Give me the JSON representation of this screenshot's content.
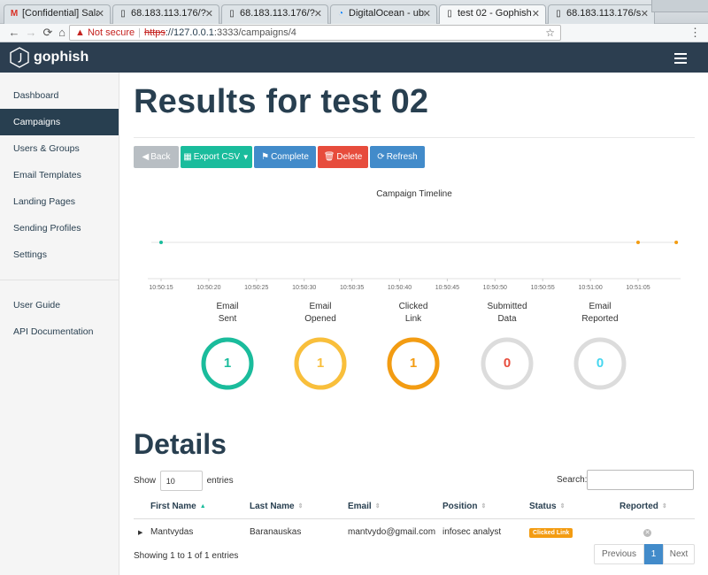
{
  "browser": {
    "tabs": [
      {
        "title": "[Confidential] Salar",
        "icon": "gmail-icon"
      },
      {
        "title": "68.183.113.176/?",
        "icon": "page-icon"
      },
      {
        "title": "68.183.113.176/?",
        "icon": "page-icon"
      },
      {
        "title": "DigitalOcean - ubun",
        "icon": "digitalocean-icon"
      },
      {
        "title": "test 02 - Gophish",
        "icon": "page-icon"
      },
      {
        "title": "68.183.113.176/s",
        "icon": "page-icon"
      }
    ],
    "active_tab": 4,
    "security": "Not secure",
    "url_scheme": "https",
    "url_host": "://127.0.0.1",
    "url_rest": ":3333/campaigns/4"
  },
  "app": {
    "brand": "gophish"
  },
  "sidebar": {
    "items": [
      {
        "label": "Dashboard"
      },
      {
        "label": "Campaigns"
      },
      {
        "label": "Users & Groups"
      },
      {
        "label": "Email Templates"
      },
      {
        "label": "Landing Pages"
      },
      {
        "label": "Sending Profiles"
      },
      {
        "label": "Settings"
      }
    ],
    "active_index": 1,
    "secondary": [
      {
        "label": "User Guide"
      },
      {
        "label": "API Documentation"
      }
    ]
  },
  "page": {
    "title": "Results for test 02"
  },
  "actions": {
    "back": "Back",
    "export": "Export CSV",
    "complete": "Complete",
    "delete": "Delete",
    "refresh": "Refresh"
  },
  "timeline": {
    "title": "Campaign Timeline",
    "ticks": [
      "10:50:15",
      "10:50:20",
      "10:50:25",
      "10:50:30",
      "10:50:35",
      "10:50:40",
      "10:50:45",
      "10:50:50",
      "10:50:55",
      "10:51:00",
      "10:51:05"
    ]
  },
  "chart_data": {
    "type": "scatter",
    "title": "Campaign Timeline",
    "x_ticks": [
      "10:50:15",
      "10:50:20",
      "10:50:25",
      "10:50:30",
      "10:50:35",
      "10:50:40",
      "10:50:45",
      "10:50:50",
      "10:50:55",
      "10:51:00",
      "10:51:05"
    ],
    "events": [
      {
        "time": "10:50:15",
        "color": "#1abc9c"
      },
      {
        "time": "10:51:05",
        "color": "#f39c12"
      },
      {
        "time": "10:51:09",
        "color": "#f39c12"
      }
    ]
  },
  "stats": [
    {
      "label1": "Email",
      "label2": "Sent",
      "value": "1",
      "color": "#1abc9c",
      "fraction": 1
    },
    {
      "label1": "Email",
      "label2": "Opened",
      "value": "1",
      "color": "#f9bf3b",
      "fraction": 1
    },
    {
      "label1": "Clicked",
      "label2": "Link",
      "value": "1",
      "color": "#f39c12",
      "fraction": 1
    },
    {
      "label1": "Submitted",
      "label2": "Data",
      "value": "0",
      "color": "#e74c3c",
      "fraction": 0
    },
    {
      "label1": "Email",
      "label2": "Reported",
      "value": "0",
      "color": "#45d6ef",
      "fraction": 0
    }
  ],
  "details": {
    "title": "Details",
    "show_label": "Show",
    "entries_value": "10",
    "entries_label": "entries",
    "search_label": "Search:",
    "columns": [
      "First Name",
      "Last Name",
      "Email",
      "Position",
      "Status",
      "Reported"
    ],
    "rows": [
      {
        "first": "Mantvydas",
        "last": "Baranauskas",
        "email": "mantvydo@gmail.com",
        "position": "infosec analyst",
        "status": "Clicked Link"
      }
    ],
    "info": "Showing 1 to 1 of 1 entries",
    "pager": {
      "prev": "Previous",
      "current": "1",
      "next": "Next"
    }
  }
}
